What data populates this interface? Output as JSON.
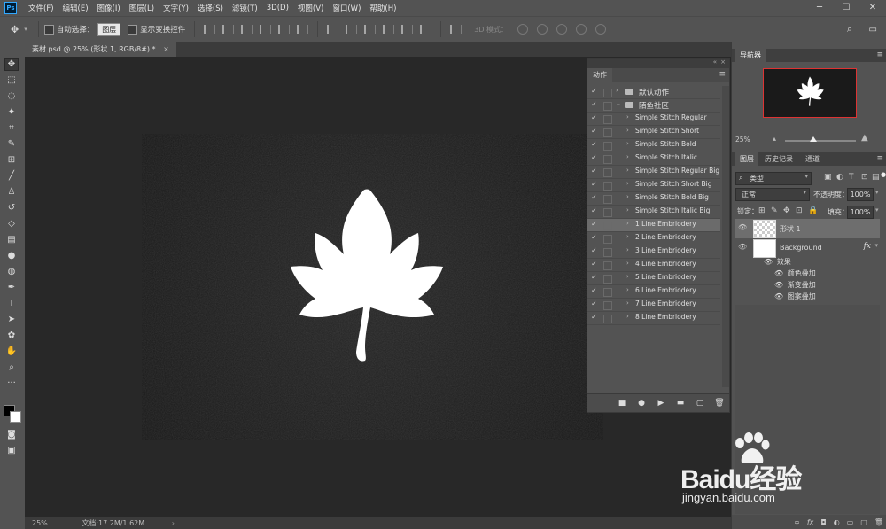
{
  "app": {
    "logo": "Ps"
  },
  "menu": [
    "文件(F)",
    "编辑(E)",
    "图像(I)",
    "图层(L)",
    "文字(Y)",
    "选择(S)",
    "滤镜(T)",
    "3D(D)",
    "视图(V)",
    "窗口(W)",
    "帮助(H)"
  ],
  "window_controls": {
    "minimize": "─",
    "maximize": "☐",
    "close": "✕"
  },
  "options": {
    "auto_select_label": "自动选择：",
    "auto_select_value": "图层",
    "show_transform_label": "显示变换控件",
    "mode_3d_label": "3D 模式："
  },
  "document": {
    "tab_title": "素材.psd @ 25% (形状 1, RGB/8#) *",
    "tab_close": "×"
  },
  "status": {
    "zoom": "25%",
    "doc_info": "文档:17.2M/1.62M"
  },
  "actions_panel": {
    "title": "动作",
    "sets": [
      {
        "name": "默认动作",
        "expanded": false
      },
      {
        "name": "陌鱼社区",
        "expanded": true
      }
    ],
    "items": [
      "Simple Stitch Regular",
      "Simple Stitch Short",
      "Simple Stitch Bold",
      "Simple Stitch Italic",
      "Simple Stitch Regular Big",
      "Simple Stitch Short Big",
      "Simple Stitch Bold Big",
      "Simple Stitch Italic Big",
      "1 Line Embriodery",
      "2 Line Embriodery",
      "3 Line Embriodery",
      "4 Line Embriodery",
      "5 Line Embriodery",
      "6 Line Embriodery",
      "7 Line Embriodery",
      "8 Line Embriodery"
    ],
    "selected_item": "1 Line Embriodery",
    "footer": {
      "stop": "■",
      "record": "●",
      "play": "▶",
      "new_set": "▬",
      "new_action": "▢",
      "delete": "🗑"
    }
  },
  "navigator": {
    "tab": "导航器",
    "zoom": "25%"
  },
  "layers_panel": {
    "tabs": [
      "图层",
      "历史记录",
      "通道"
    ],
    "filter_label": "类型",
    "blend_mode": "正常",
    "opacity_label": "不透明度：",
    "opacity_value": "100%",
    "lock_label": "锁定：",
    "fill_label": "填充：",
    "fill_value": "100%",
    "layers": [
      {
        "name": "形状 1",
        "selected": true
      },
      {
        "name": "Background",
        "selected": false,
        "fx": "fx"
      }
    ],
    "effects_label": "效果",
    "effects": [
      "颜色叠加",
      "渐变叠加",
      "图案叠加"
    ],
    "bottom_icons": [
      "∞",
      "fx",
      "◘",
      "◐",
      "▭",
      "▢",
      "🗑"
    ]
  },
  "watermark": {
    "logo": "Baidu经验",
    "url": "jingyan.baidu.com"
  },
  "colors": {
    "accent": "#31a8ff",
    "bg_dark": "#282828",
    "panel": "#535353",
    "nav_border": "#dd3333"
  }
}
